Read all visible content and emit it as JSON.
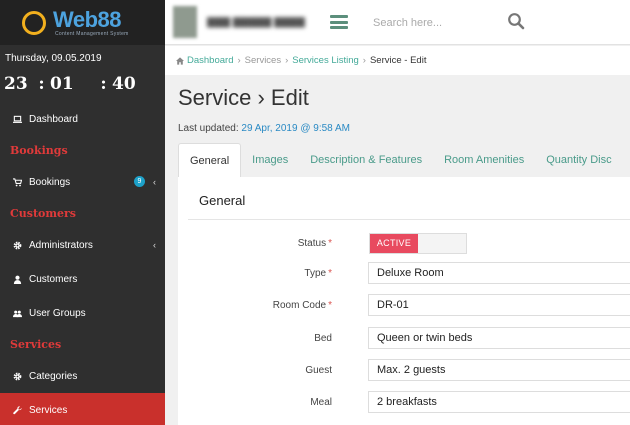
{
  "brand": {
    "name": "Web88",
    "tagline": "Content Management System"
  },
  "sidebar": {
    "date": "Thursday, 09.05.2019",
    "clock": {
      "h": "23",
      "m": "01",
      "s": "40",
      "sep": ":"
    },
    "items": [
      {
        "type": "link",
        "label": "Dashboard",
        "icon": "laptop-icon"
      },
      {
        "type": "section",
        "label": "Bookings"
      },
      {
        "type": "link",
        "label": "Bookings",
        "icon": "cart-icon",
        "badge": "9",
        "chevron": "‹"
      },
      {
        "type": "section",
        "label": "Customers"
      },
      {
        "type": "link",
        "label": "Administrators",
        "icon": "gear-icon",
        "chevron": "‹"
      },
      {
        "type": "link",
        "label": "Customers",
        "icon": "user-icon"
      },
      {
        "type": "link",
        "label": "User Groups",
        "icon": "users-icon"
      },
      {
        "type": "section",
        "label": "Services"
      },
      {
        "type": "link",
        "label": "Categories",
        "icon": "gear-icon"
      },
      {
        "type": "link",
        "label": "Services",
        "icon": "wrench-icon",
        "active": true
      }
    ]
  },
  "topbar": {
    "search_placeholder": "Search here..."
  },
  "breadcrumb": {
    "items": [
      "Dashboard",
      "Services",
      "Services Listing",
      "Service - Edit"
    ],
    "separator": "›"
  },
  "page": {
    "title": "Service › Edit",
    "updated_label": "Last updated:",
    "updated_value": "29 Apr, 2019 @ 9:58 AM"
  },
  "tabs": [
    "General",
    "Images",
    "Description & Features",
    "Room Amenities",
    "Quantity Disc"
  ],
  "panel": {
    "heading": "General",
    "status": {
      "label": "Status",
      "value": "ACTIVE",
      "required": "*"
    },
    "fields": [
      {
        "label": "Type",
        "value": "Deluxe Room",
        "required": "*"
      },
      {
        "label": "Room Code",
        "value": "DR-01",
        "required": "*"
      },
      {
        "label": "Bed",
        "value": "Queen or twin beds",
        "required": ""
      },
      {
        "label": "Guest",
        "value": "Max. 2 guests",
        "required": ""
      },
      {
        "label": "Meal",
        "value": "2 breakfasts",
        "required": ""
      }
    ]
  },
  "colors": {
    "accent": "#4da3df",
    "danger": "#c9302c",
    "toggle_on": "#e84a5f",
    "link": "#4a9b8a"
  }
}
